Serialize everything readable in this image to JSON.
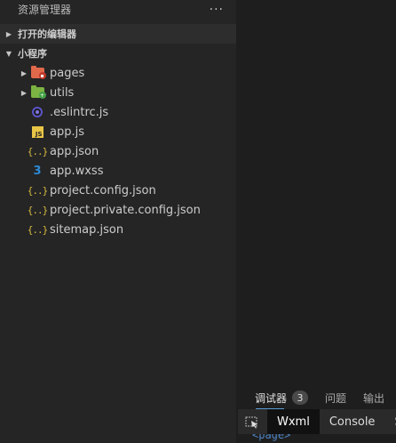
{
  "explorer": {
    "title": "资源管理器",
    "more_label": "···",
    "sections": {
      "open_editors": "打开的编辑器",
      "project": "小程序"
    },
    "items": [
      {
        "label": "pages",
        "icon": "folder-pages-icon",
        "color": "#e0684b",
        "badge_color": "#c0392b"
      },
      {
        "label": "utils",
        "icon": "folder-utils-icon",
        "color": "#7cb342",
        "badge_color": "#43a047"
      },
      {
        "label": ".eslintrc.js",
        "icon": "eslint-icon"
      },
      {
        "label": "app.js",
        "icon": "js-icon"
      },
      {
        "label": "app.json",
        "icon": "json-icon"
      },
      {
        "label": "app.wxss",
        "icon": "css-icon"
      },
      {
        "label": "project.config.json",
        "icon": "json-icon"
      },
      {
        "label": "project.private.config.json",
        "icon": "json-icon"
      },
      {
        "label": "sitemap.json",
        "icon": "json-icon"
      }
    ]
  },
  "devtools": {
    "tabs": [
      {
        "label": "调试器",
        "badge": "3"
      },
      {
        "label": "问题"
      },
      {
        "label": "输出"
      }
    ],
    "subtabs": [
      "Wxml",
      "Console",
      "S"
    ],
    "content_text": "<page>"
  },
  "colors": {
    "sidebar_bg": "#252526",
    "editor_bg": "#1e1e1e",
    "accent": "#5b9bd5"
  }
}
